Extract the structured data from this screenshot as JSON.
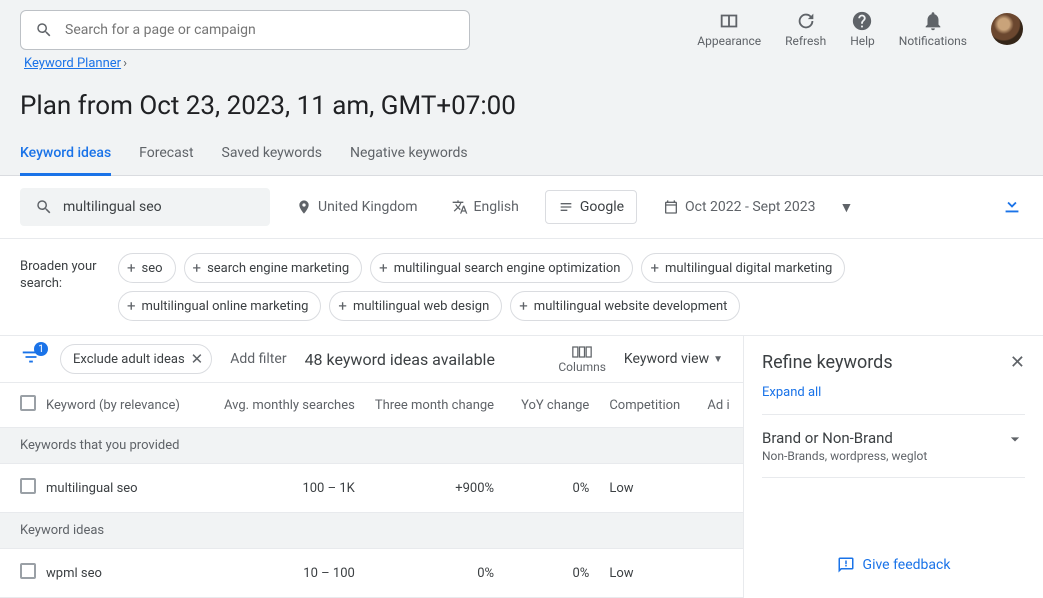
{
  "search": {
    "placeholder": "Search for a page or campaign"
  },
  "topActions": {
    "appearance": "Appearance",
    "refresh": "Refresh",
    "help": "Help",
    "notifications": "Notifications"
  },
  "breadcrumb": {
    "label": "Keyword Planner"
  },
  "pageTitle": "Plan from Oct 23, 2023, 11 am, GMT+07:00",
  "tabs": {
    "ideas": "Keyword ideas",
    "forecast": "Forecast",
    "saved": "Saved keywords",
    "negative": "Negative keywords"
  },
  "kwInput": "multilingual seo",
  "filters": {
    "location": "United Kingdom",
    "language": "English",
    "network": "Google",
    "dateRange": "Oct 2022 - Sept 2023"
  },
  "broadenLabel": "Broaden your search:",
  "broaden": [
    "seo",
    "search engine marketing",
    "multilingual search engine optimization",
    "multilingual digital marketing",
    "multilingual online marketing",
    "multilingual web design",
    "multilingual website development"
  ],
  "funnelBadge": "1",
  "excludePill": "Exclude adult ideas",
  "addFilter": "Add filter",
  "ideasAvailable": "48 keyword ideas available",
  "columnsLabel": "Columns",
  "viewLabel": "Keyword view",
  "tableHead": {
    "keyword": "Keyword (by relevance)",
    "searches": "Avg. monthly searches",
    "threeMonth": "Three month change",
    "yoy": "YoY change",
    "competition": "Competition",
    "adi": "Ad i"
  },
  "sections": {
    "provided": "Keywords that you provided",
    "ideas": "Keyword ideas"
  },
  "rows": {
    "provided": [
      {
        "keyword": "multilingual seo",
        "searches": "100 – 1K",
        "threeMonth": "+900%",
        "yoy": "0%",
        "competition": "Low"
      }
    ],
    "ideas": [
      {
        "keyword": "wpml seo",
        "searches": "10 – 100",
        "threeMonth": "0%",
        "yoy": "0%",
        "competition": "Low"
      }
    ]
  },
  "refine": {
    "title": "Refine keywords",
    "expand": "Expand all",
    "brandTitle": "Brand or Non-Brand",
    "brandSub": "Non-Brands, wordpress, weglot",
    "feedback": "Give feedback"
  }
}
